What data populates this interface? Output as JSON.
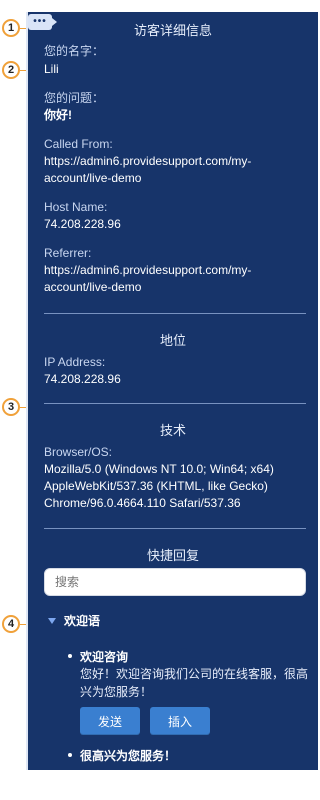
{
  "markers": [
    "1",
    "2",
    "3",
    "4"
  ],
  "header": {
    "title": "访客详细信息",
    "chat_icon_text": "•••"
  },
  "visitor": {
    "name_label": "您的名字：",
    "name_value": "Lili",
    "question_label": "您的问题：",
    "question_value": "你好!",
    "called_from_label": "Called From:",
    "called_from_value_line1": "https://admin6.providesupport.com/my-",
    "called_from_value_line2": "account/live-demo",
    "host_label": "Host Name:",
    "host_value": "74.208.228.96",
    "referrer_label": "Referrer:",
    "referrer_value_line1": "https://admin6.providesupport.com/my-",
    "referrer_value_line2": "account/live-demo"
  },
  "location": {
    "title": "地位",
    "ip_label": "IP Address:",
    "ip_value": "74.208.228.96"
  },
  "tech": {
    "title": "技术",
    "browser_label": "Browser/OS:",
    "browser_line1": "Mozilla/5.0 (Windows NT 10.0; Win64; x64)",
    "browser_line2": "AppleWebKit/537.36 (KHTML, like Gecko)",
    "browser_line3": "Chrome/96.0.4664.110 Safari/537.36"
  },
  "quick_reply": {
    "title": "快捷回复",
    "search_placeholder": "搜索",
    "group_label": "欢迎语",
    "item_title": "欢迎咨询",
    "item_text": "您好！欢迎咨询我们公司的在线客服，很高兴为您服务！",
    "send_label": "发送",
    "insert_label": "插入",
    "item2_title": "很高兴为您服务！"
  },
  "colors": {
    "panel_bg": "#17346a",
    "accent": "#3a7fd0",
    "marker": "#f0a13a"
  }
}
